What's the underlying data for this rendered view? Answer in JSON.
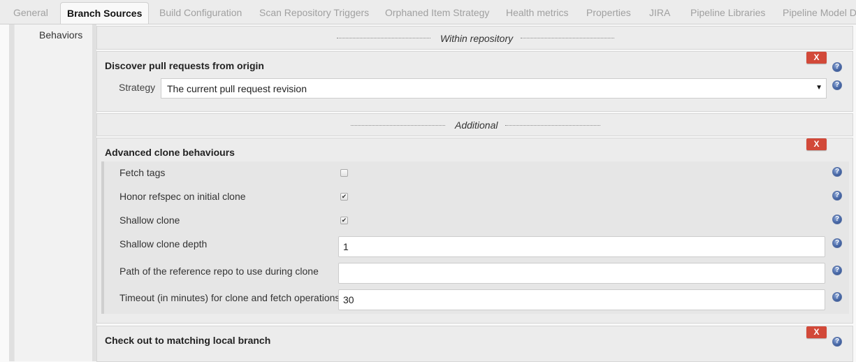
{
  "tabs": [
    {
      "label": "General",
      "active": false
    },
    {
      "label": "Branch Sources",
      "active": true
    },
    {
      "label": "Build Configuration",
      "active": false
    },
    {
      "label": "Scan Repository Triggers",
      "active": false
    },
    {
      "label": "Orphaned Item Strategy",
      "active": false
    },
    {
      "label": "Health metrics",
      "active": false
    },
    {
      "label": "Properties",
      "active": false
    },
    {
      "label": "JIRA",
      "active": false
    },
    {
      "label": "Pipeline Libraries",
      "active": false
    },
    {
      "label": "Pipeline Model De",
      "active": false
    }
  ],
  "sidebar": {
    "label": "Behaviors"
  },
  "sections": {
    "within_repository": "Within repository",
    "additional": "Additional"
  },
  "discover_pr": {
    "title": "Discover pull requests from origin",
    "remove_label": "X",
    "strategy_label": "Strategy",
    "strategy_value": "The current pull request revision",
    "dropdown_arrow": "▼"
  },
  "advanced_clone": {
    "title": "Advanced clone behaviours",
    "remove_label": "X",
    "fetch_tags": {
      "label": "Fetch tags",
      "checked": false
    },
    "honor_refspec": {
      "label": "Honor refspec on initial clone",
      "checked": true
    },
    "shallow_clone": {
      "label": "Shallow clone",
      "checked": true
    },
    "shallow_depth": {
      "label": "Shallow clone depth",
      "value": "1"
    },
    "reference_repo": {
      "label": "Path of the reference repo to use during clone",
      "value": ""
    },
    "timeout": {
      "label": "Timeout (in minutes) for clone and fetch operations",
      "value": "30"
    }
  },
  "checkout_local": {
    "title": "Check out to matching local branch",
    "remove_label": "X"
  },
  "icons": {
    "help": "?",
    "check": "✔"
  },
  "colors": {
    "remove_button": "#d24939",
    "help_icon": "#4a6aa8"
  }
}
